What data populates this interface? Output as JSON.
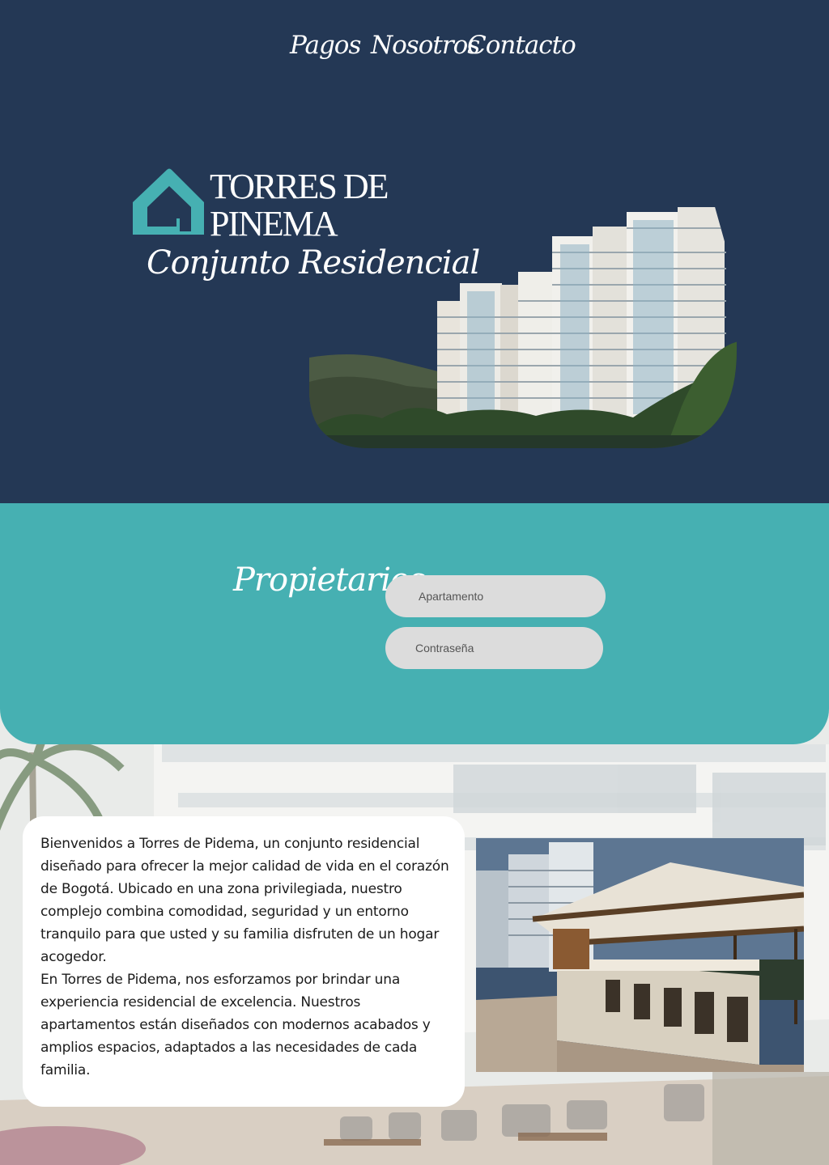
{
  "nav": {
    "items": [
      {
        "label": "Pagos"
      },
      {
        "label": "Nosotros"
      },
      {
        "label": "Contacto"
      }
    ]
  },
  "hero": {
    "brand_line1": "TORRES DE",
    "brand_line2": "PINEMA",
    "tagline": "Conjunto Residencial",
    "logo_icon": "house-icon"
  },
  "owners": {
    "title": "Propietarios",
    "apartment_placeholder": "Apartamento",
    "password_placeholder": "Contraseña"
  },
  "welcome": {
    "paragraph1": "Bienvenidos a Torres de Pidema, un conjunto residencial diseñado para ofrecer la mejor calidad de vida en el corazón de Bogotá. Ubicado en una zona privilegiada, nuestro complejo combina comodidad, seguridad y un entorno tranquilo para que usted y su familia disfruten de un hogar acogedor.",
    "paragraph2": "En Torres de Pidema, nos esforzamos por brindar una experiencia residencial de excelencia. Nuestros apartamentos están diseñados con modernos acabados y amplios espacios, adaptados a las necesidades de cada familia."
  },
  "colors": {
    "navy": "#243855",
    "teal": "#46b0b2",
    "field": "#dcdcdc"
  }
}
